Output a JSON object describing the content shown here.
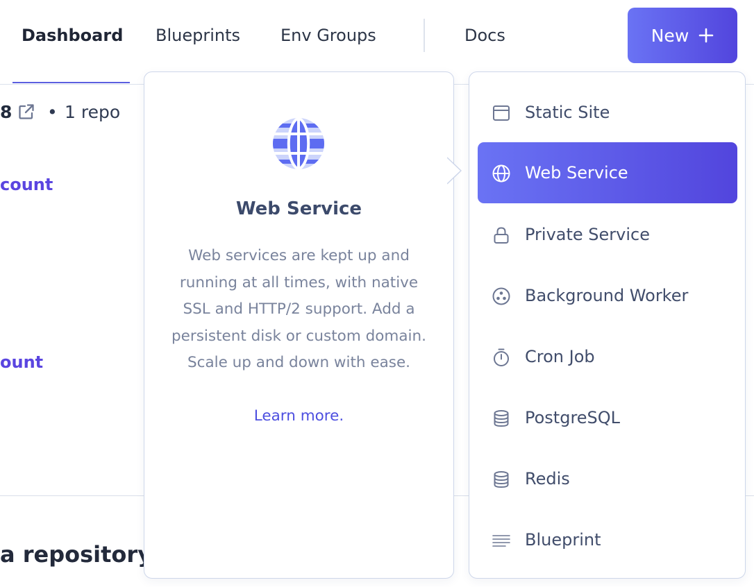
{
  "nav": {
    "items": [
      {
        "label": "Dashboard",
        "active": true
      },
      {
        "label": "Blueprints",
        "active": false
      },
      {
        "label": "Env Groups",
        "active": false
      },
      {
        "label": "Docs",
        "active": false
      }
    ],
    "new_button": {
      "label": "New",
      "icon": "plus-icon"
    }
  },
  "background": {
    "owner_tail": "8",
    "external_link_icon": "external-link-icon",
    "separator": "•",
    "repo_count": "1 repo",
    "link_1": "count",
    "link_2": "ount",
    "heading": "a repository"
  },
  "description": {
    "icon": "globe-icon",
    "title": "Web Service",
    "body": "Web services are kept up and running at all times, with native SSL and HTTP/2 support. Add a persistent disk or custom domain. Scale up and down with ease.",
    "learn_more": "Learn more."
  },
  "menu": {
    "items": [
      {
        "label": "Static Site",
        "icon": "browser-window-icon",
        "selected": false
      },
      {
        "label": "Web Service",
        "icon": "globe-icon",
        "selected": true
      },
      {
        "label": "Private Service",
        "icon": "lock-icon",
        "selected": false
      },
      {
        "label": "Background Worker",
        "icon": "worker-dots-icon",
        "selected": false
      },
      {
        "label": "Cron Job",
        "icon": "stopwatch-icon",
        "selected": false
      },
      {
        "label": "PostgreSQL",
        "icon": "database-icon",
        "selected": false
      },
      {
        "label": "Redis",
        "icon": "database-icon",
        "selected": false
      },
      {
        "label": "Blueprint",
        "icon": "lines-icon",
        "selected": false
      }
    ]
  },
  "colors": {
    "accent_gradient_start": "#6a73f4",
    "accent_gradient_end": "#5245dd",
    "link": "#5a45e0",
    "panel_border": "#cdd6ea",
    "icon_gray": "#6c7692"
  }
}
